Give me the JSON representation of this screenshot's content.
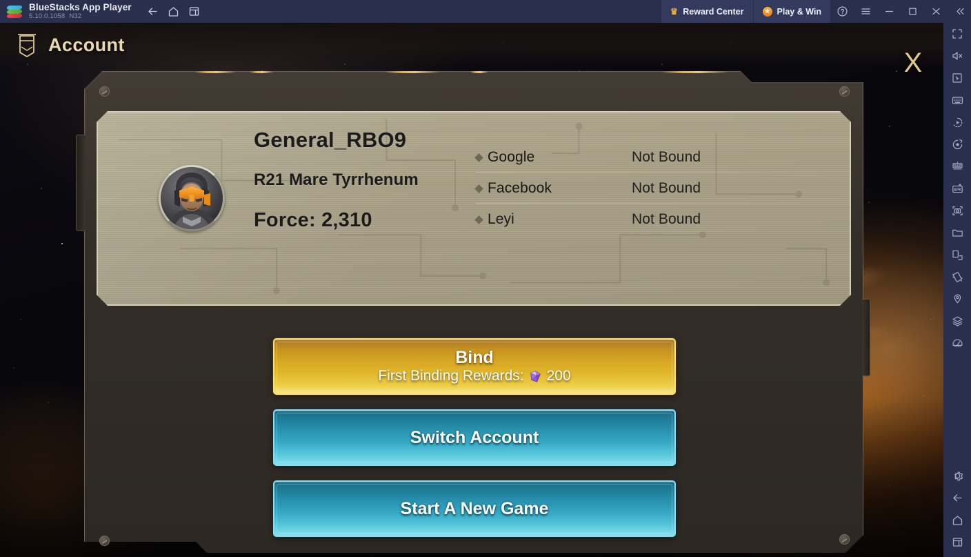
{
  "titlebar": {
    "app_name": "BlueStacks App Player",
    "version": "5.10.0.1058",
    "version_tag": "N32",
    "nav": [
      {
        "name": "back-icon",
        "label": "Back"
      },
      {
        "name": "home-icon",
        "label": "Home"
      },
      {
        "name": "multi-instance-icon",
        "label": "Multi-instance"
      }
    ],
    "reward_center": "Reward Center",
    "play_and_win": "Play & Win",
    "help_label": "Help",
    "menu_label": "Menu",
    "minimize_label": "Minimize",
    "maximize_label": "Maximize",
    "close_label": "Close",
    "collapse_label": "Collapse",
    "bg_color": "#2b2f4e",
    "pill_color": "#343a5e"
  },
  "game": {
    "header": {
      "title": "Account",
      "icon": "banner-icon",
      "close_label": "X",
      "title_color": "#ead9b4"
    },
    "player": {
      "name": "General_RBO9",
      "server": "R21 Mare Tyrrhenum",
      "force": "Force: 2,310",
      "avatar_alt": "General avatar"
    },
    "bindings": [
      {
        "platform": "Google",
        "status": "Not Bound"
      },
      {
        "platform": "Facebook",
        "status": "Not Bound"
      },
      {
        "platform": "Leyi",
        "status": "Not Bound"
      }
    ],
    "buttons": {
      "bind": {
        "title": "Bind",
        "subtitle": "First Binding Rewards:",
        "reward_amount": "200",
        "reward_icon": "gem-icon",
        "accent": "#e0b62a"
      },
      "switch_account": "Switch Account",
      "start_new_game": "Start A New Game",
      "blue_accent": "#36a8c4"
    }
  },
  "sidebar": {
    "top_items": [
      {
        "name": "fullscreen-icon",
        "label": "Full screen"
      },
      {
        "name": "mute-icon",
        "label": "Mute"
      },
      {
        "name": "cursor-icon",
        "label": "Game controls"
      },
      {
        "name": "keyboard-icon",
        "label": "Keymapping"
      },
      {
        "name": "macro-record-icon",
        "label": "Macro recorder"
      },
      {
        "name": "sync-icon",
        "label": "Sync operations"
      },
      {
        "name": "multi-instance-sync-icon",
        "label": "Instance manager"
      },
      {
        "name": "install-apk-icon",
        "label": "Install APK"
      },
      {
        "name": "screenshot-icon",
        "label": "Screenshot"
      },
      {
        "name": "media-folder-icon",
        "label": "Media manager"
      },
      {
        "name": "rotate-icon",
        "label": "Rotate"
      },
      {
        "name": "shake-icon",
        "label": "Shake"
      },
      {
        "name": "location-icon",
        "label": "Location"
      },
      {
        "name": "layers-icon",
        "label": "Eco mode"
      },
      {
        "name": "performance-icon",
        "label": "Performance"
      }
    ],
    "bottom_items": [
      {
        "name": "gear-icon",
        "label": "Settings"
      },
      {
        "name": "back-icon",
        "label": "Back"
      },
      {
        "name": "home-icon",
        "label": "Home"
      },
      {
        "name": "recents-icon",
        "label": "Recent apps"
      }
    ]
  }
}
